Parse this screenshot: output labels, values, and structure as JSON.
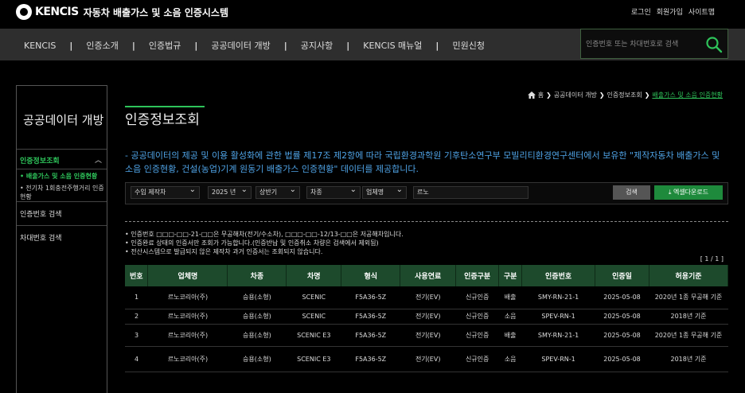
{
  "header": {
    "logo_text": "KENCIS",
    "logo_subtitle": "자동차 배출가스 및 소음 인증시스템",
    "util_links": [
      "로그인",
      "회원가입",
      "사이트맵"
    ]
  },
  "nav": {
    "items": [
      "KENCIS",
      "인증소개",
      "인증법규",
      "공공데이터 개방",
      "공지사항",
      "KENCIS 매뉴얼",
      "민원신청"
    ],
    "separator": "|",
    "search_placeholder": "인증번호 또는 차대번호로 검색",
    "search_icon": "search-icon"
  },
  "sidebar": {
    "title": "공공데이터 개방",
    "section_label": "인증정보조회",
    "sub_items": [
      "• 배출가스 및 소음 인증현황",
      "• 전기차 1회충전주행거리 인증현황"
    ],
    "items": [
      "인증번호 검색",
      "차대번호 검색"
    ]
  },
  "breadcrumb": {
    "items": [
      "홈",
      "공공데이터 개방",
      "인증정보조회",
      "배출가스 및 소음 인증현황"
    ],
    "home_icon": "home-icon"
  },
  "main": {
    "title": "인증정보조회",
    "description": "- 공공데이터의 제공 및 이용 활성화에 관한 법률 제17조 제2항에 따라 국립환경과학원 기후탄소연구부 모빌리티환경연구센터에서 보유한 \"제작자동차 배출가스 및 소음 인증현황, 건설(농업)기계 원동기 배출가스 인증현황\" 데이터를 제공합니다."
  },
  "filters": {
    "type": "수입 제작차",
    "year": "2025 년",
    "half": "상반기",
    "car_type": "차종",
    "company_type": "업체명",
    "keyword": "르노",
    "search_label": "검색",
    "excel_label": "엑셀다운로드"
  },
  "notes": [
    "• 인증번호 □□□-□□-21-□□은 무공해차(전기/수소차), □□□-□□-12/13-□□은 저공해차입니다.",
    "• 인증완료 상태의 인증서만 조회가 가능합니다.(인증반납 및 인증취소 차량은 검색에서 제외됨)",
    "• 전산시스템으로 발급되지 않은 제작차 과거 인증서는 조회되지 않습니다."
  ],
  "pager": "[ 1 / 1 ]",
  "table": {
    "headers": [
      "번호",
      "업체명",
      "차종",
      "차명",
      "형식",
      "사용연료",
      "인증구분",
      "구분",
      "인증번호",
      "인증일",
      "허용기준"
    ],
    "rows": [
      [
        "1",
        "르노코리아(주)",
        "승용(소형)",
        "SCENIC",
        "F5A36-5Z",
        "전기(EV)",
        "신규인증",
        "배출",
        "SMY-RN-21-1",
        "2025-05-08",
        "2020년 1종 무공해 기준"
      ],
      [
        "2",
        "르노코리아(주)",
        "승용(소형)",
        "SCENIC",
        "F5A36-5Z",
        "전기(EV)",
        "신규인증",
        "소음",
        "SPEV-RN-1",
        "2025-05-08",
        "2018년 기준"
      ],
      [
        "3",
        "르노코리아(주)",
        "승용(소형)",
        "SCENIC E3",
        "F5A36-5Z",
        "전기(EV)",
        "신규인증",
        "배출",
        "SMY-RN-21-1",
        "2025-05-08",
        "2020년 1종 무공해 기준"
      ],
      [
        "4",
        "르노코리아(주)",
        "승용(소형)",
        "SCENIC E3",
        "F5A36-5Z",
        "전기(EV)",
        "신규인증",
        "소음",
        "SPEV-RN-1",
        "2025-05-08",
        "2018년 기준"
      ]
    ]
  },
  "colors": {
    "accent_green": "#2ec35a",
    "table_header": "#1d4a2c",
    "excel_button": "#1e8a3c",
    "description_blue": "#4fa3e6"
  }
}
